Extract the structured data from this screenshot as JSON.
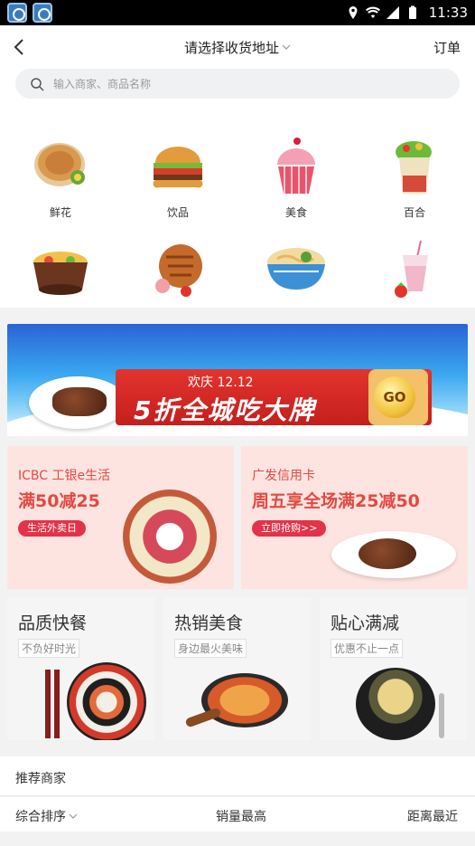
{
  "status_bar": {
    "time": "11:33"
  },
  "header": {
    "address_title": "请选择收货地址",
    "orders_label": "订单"
  },
  "search": {
    "placeholder": "输入商家、商品名称"
  },
  "categories": [
    {
      "label": "鲜花",
      "icon": "pancake-icon"
    },
    {
      "label": "饮品",
      "icon": "burger-icon"
    },
    {
      "label": "美食",
      "icon": "cupcake-icon"
    },
    {
      "label": "百合",
      "icon": "wrap-icon"
    },
    {
      "label": "",
      "icon": "hotpot-icon"
    },
    {
      "label": "",
      "icon": "meat-skewer-icon"
    },
    {
      "label": "",
      "icon": "noodle-bowl-icon"
    },
    {
      "label": "",
      "icon": "milkshake-icon"
    }
  ],
  "banner": {
    "top_label": "欢庆 12.12",
    "headline": "5折全城吃大牌",
    "go_label": "GO"
  },
  "promos": [
    {
      "bank": "ICBC 工银e生活",
      "offer": "满50减25",
      "pill": "生活外卖日"
    },
    {
      "bank": "广发信用卡",
      "offer": "周五享全场满25减50",
      "pill": "立即抢购>>"
    }
  ],
  "features": [
    {
      "title": "品质快餐",
      "subtitle": "不负好时光"
    },
    {
      "title": "热销美食",
      "subtitle": "身边最火美味"
    },
    {
      "title": "贴心满减",
      "subtitle": "优惠不止一点"
    }
  ],
  "recommend": {
    "title": "推荐商家"
  },
  "sort": {
    "comprehensive": "综合排序",
    "sales": "销量最高",
    "distance": "距离最近"
  },
  "colors": {
    "accent_red": "#e24a42",
    "promo_bg": "#fde4e1",
    "banner_blue": "#2b63d6"
  }
}
